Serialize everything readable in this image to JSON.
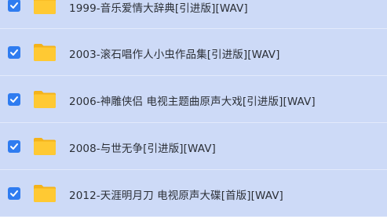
{
  "file_list": {
    "items": [
      {
        "name": "1999-音乐爱情大辞典[引进版][WAV]",
        "checked": true,
        "icon": "folder-icon"
      },
      {
        "name": "2003-滚石唱作人小虫作品集[引进版][WAV]",
        "checked": true,
        "icon": "folder-icon"
      },
      {
        "name": "2006-神雕侠侣 电视主题曲原声大戏[引进版][WAV]",
        "checked": true,
        "icon": "folder-icon"
      },
      {
        "name": "2008-与世无争[引进版][WAV]",
        "checked": true,
        "icon": "folder-icon"
      },
      {
        "name": "2012-天涯明月刀 电视原声大碟[首版][WAV]",
        "checked": true,
        "icon": "folder-icon"
      }
    ]
  },
  "colors": {
    "background": "#cfdcf8",
    "checkbox": "#2f7cf0",
    "folder": "#ffc933",
    "folder_back": "#f4b31a"
  }
}
